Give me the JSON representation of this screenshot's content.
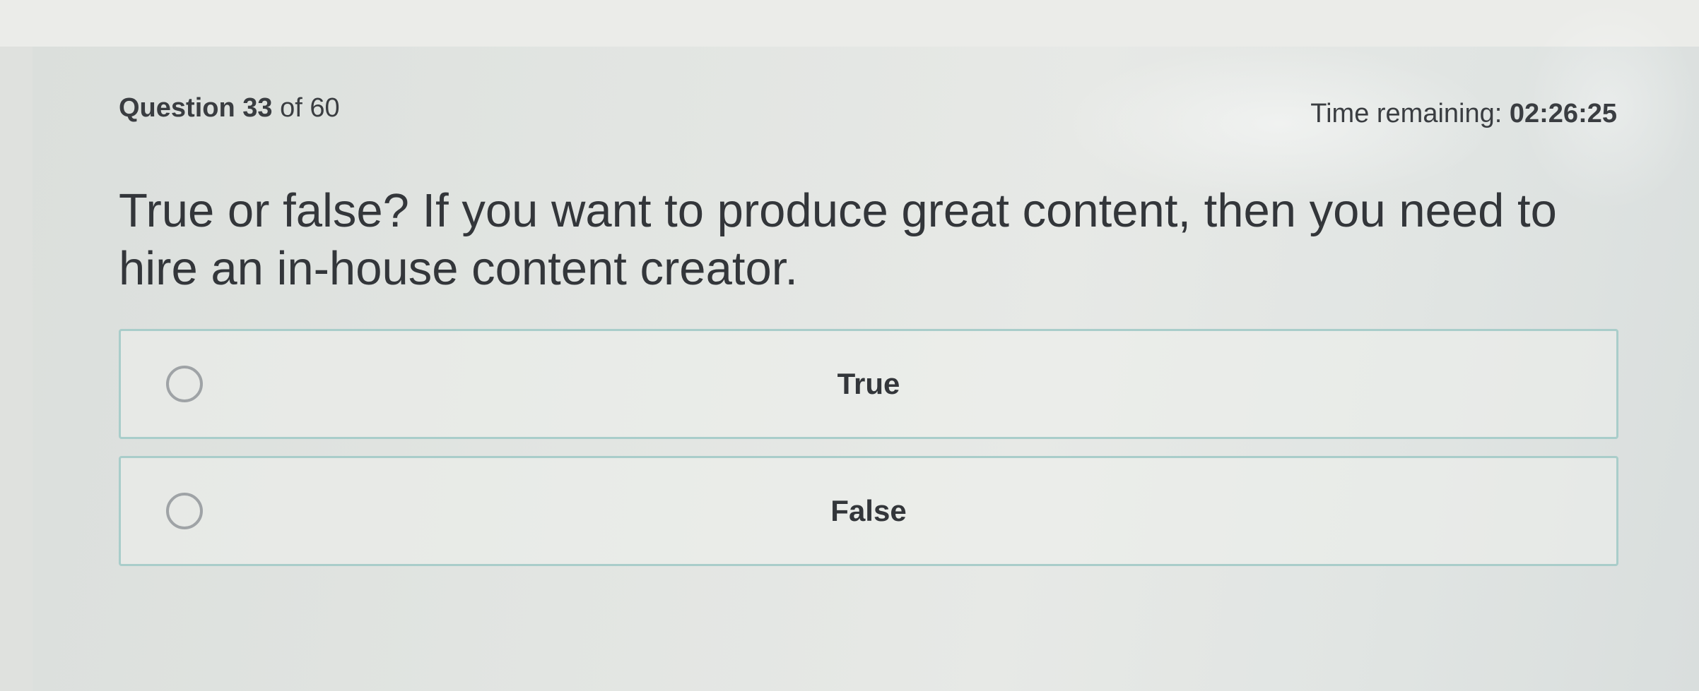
{
  "header": {
    "question_word": "Question",
    "question_number": "33",
    "of_total": "of 60",
    "timer_label": "Time remaining:",
    "timer_value": "02:26:25"
  },
  "question": {
    "text": "True or false? If you want to produce great content, then you need to hire an in-house content creator."
  },
  "options": [
    {
      "label": "True",
      "selected": false
    },
    {
      "label": "False",
      "selected": false
    }
  ],
  "colors": {
    "option_border": "#a9cdca",
    "radio_border": "#9fa3a6",
    "text": "#33363a"
  }
}
